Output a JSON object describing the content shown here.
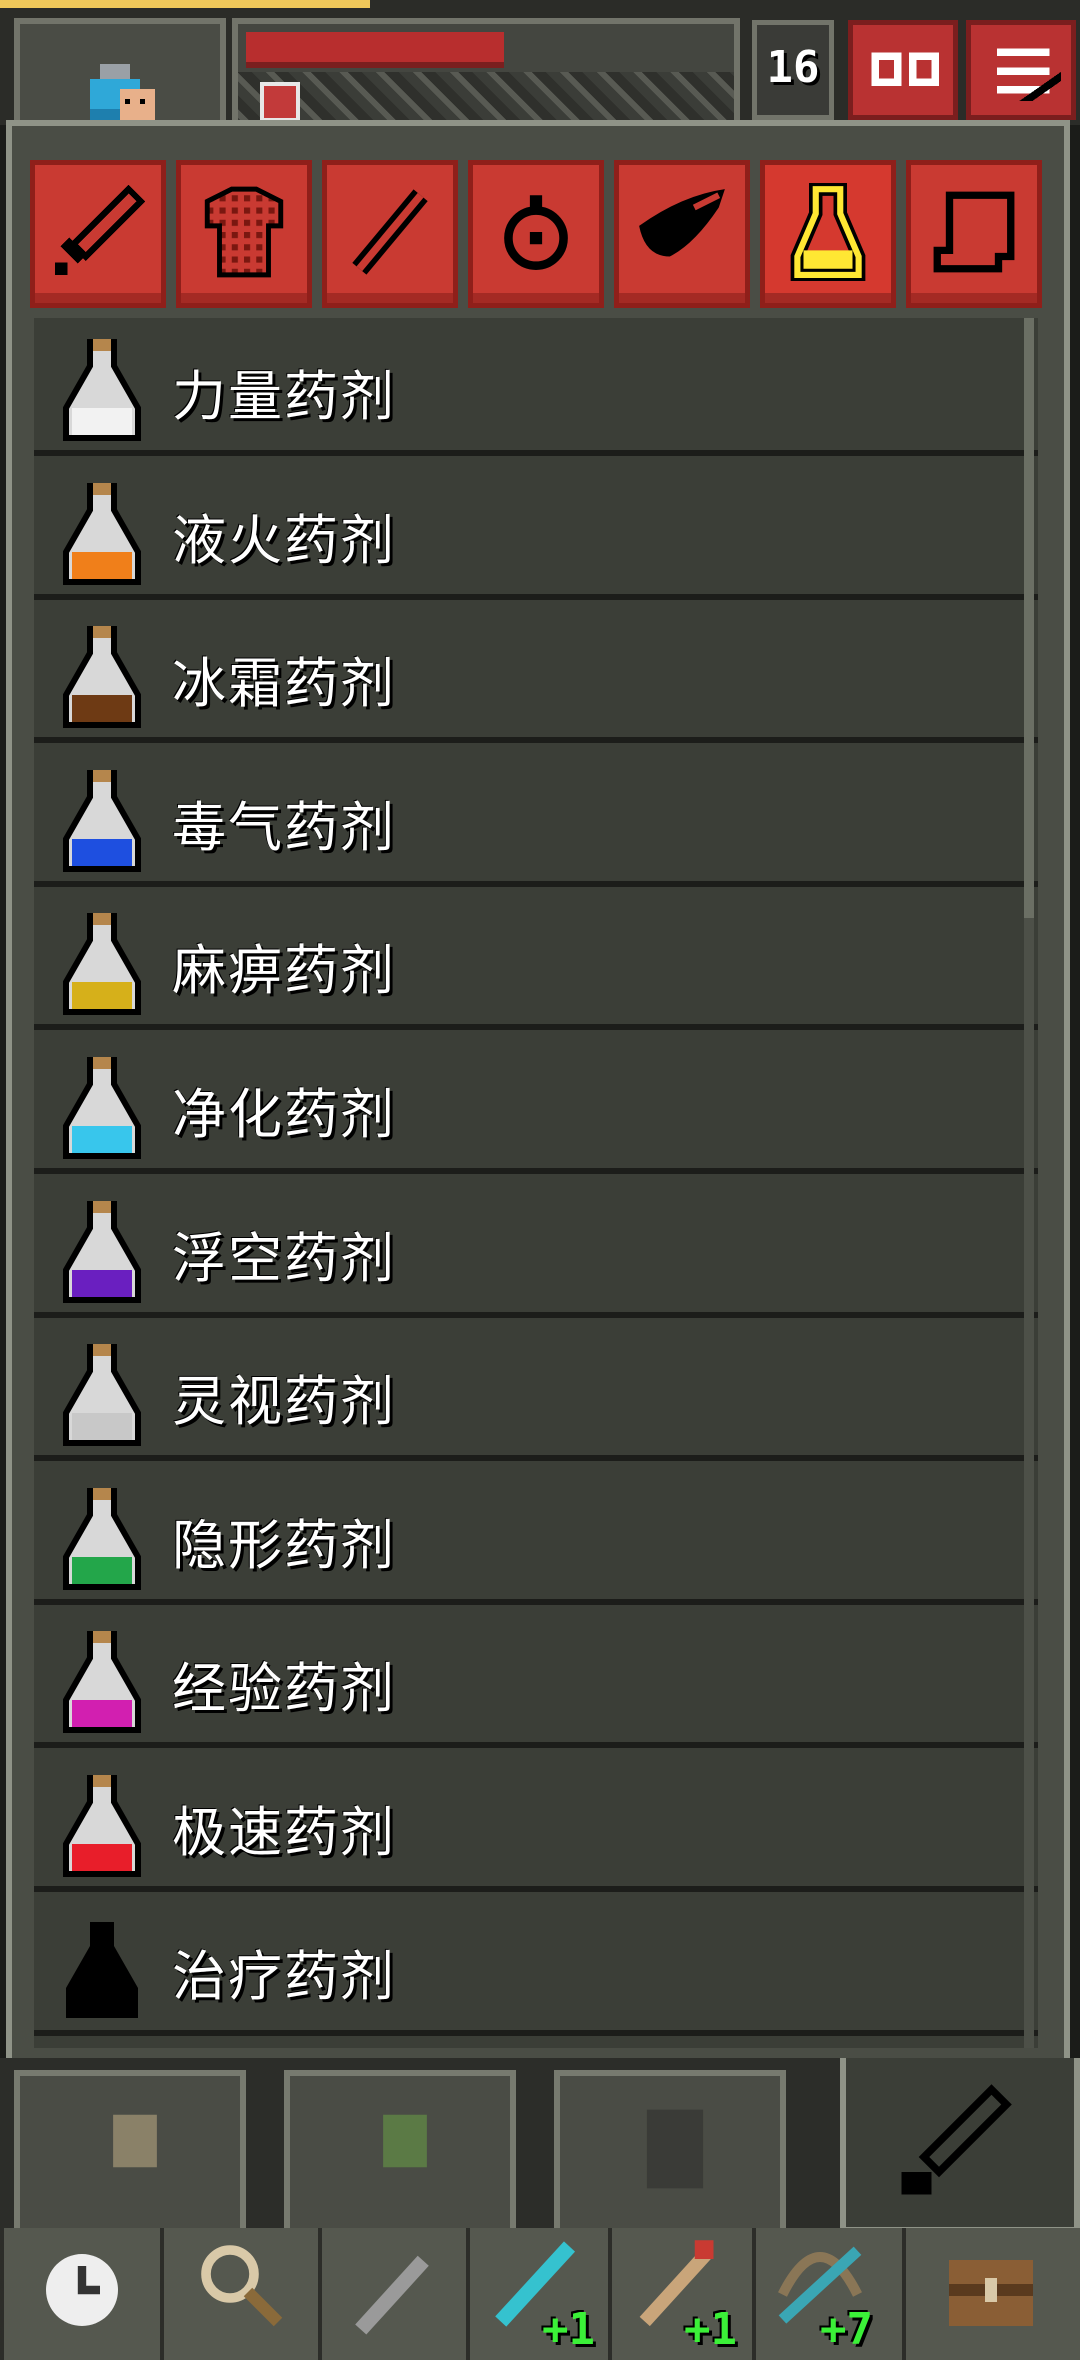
{
  "hud": {
    "depth": "16",
    "hp_fraction": 0.52,
    "icons": [
      "hero-portrait-icon",
      "buff-icon",
      "journal-icon",
      "menu-icon"
    ]
  },
  "catalog": {
    "tabs": [
      {
        "name": "weapons",
        "icon": "sword-icon",
        "active": false
      },
      {
        "name": "armor",
        "icon": "armor-icon",
        "active": false
      },
      {
        "name": "wands",
        "icon": "wand-icon",
        "active": false
      },
      {
        "name": "rings",
        "icon": "ring-icon",
        "active": false
      },
      {
        "name": "artifacts",
        "icon": "horn-icon",
        "active": false
      },
      {
        "name": "potions",
        "icon": "potion-icon",
        "active": true
      },
      {
        "name": "scrolls",
        "icon": "scroll-icon",
        "active": false
      }
    ],
    "potions": [
      {
        "label": "力量药剂",
        "color": "#f2f2f2"
      },
      {
        "label": "液火药剂",
        "color": "#f07f1a"
      },
      {
        "label": "冰霜药剂",
        "color": "#6e3a14"
      },
      {
        "label": "毒气药剂",
        "color": "#1e4fe0"
      },
      {
        "label": "麻痹药剂",
        "color": "#d6b01a"
      },
      {
        "label": "净化药剂",
        "color": "#38c6ec"
      },
      {
        "label": "浮空药剂",
        "color": "#6a1fc0"
      },
      {
        "label": "灵视药剂",
        "color": "#c8c8c8"
      },
      {
        "label": "隐形药剂",
        "color": "#23a64a"
      },
      {
        "label": "经验药剂",
        "color": "#d21fb0"
      },
      {
        "label": "极速药剂",
        "color": "#e81e2a"
      },
      {
        "label": "治疗药剂",
        "color": "#000000"
      }
    ]
  },
  "toolbar": {
    "upgrades": [
      "+1",
      "+1",
      "+7"
    ],
    "icons": [
      "wait-icon",
      "search-icon",
      "quickslot-dagger-icon",
      "quickslot-spear-icon",
      "quickslot-staff-icon",
      "quickslot-bow-icon",
      "backpack-icon"
    ]
  }
}
